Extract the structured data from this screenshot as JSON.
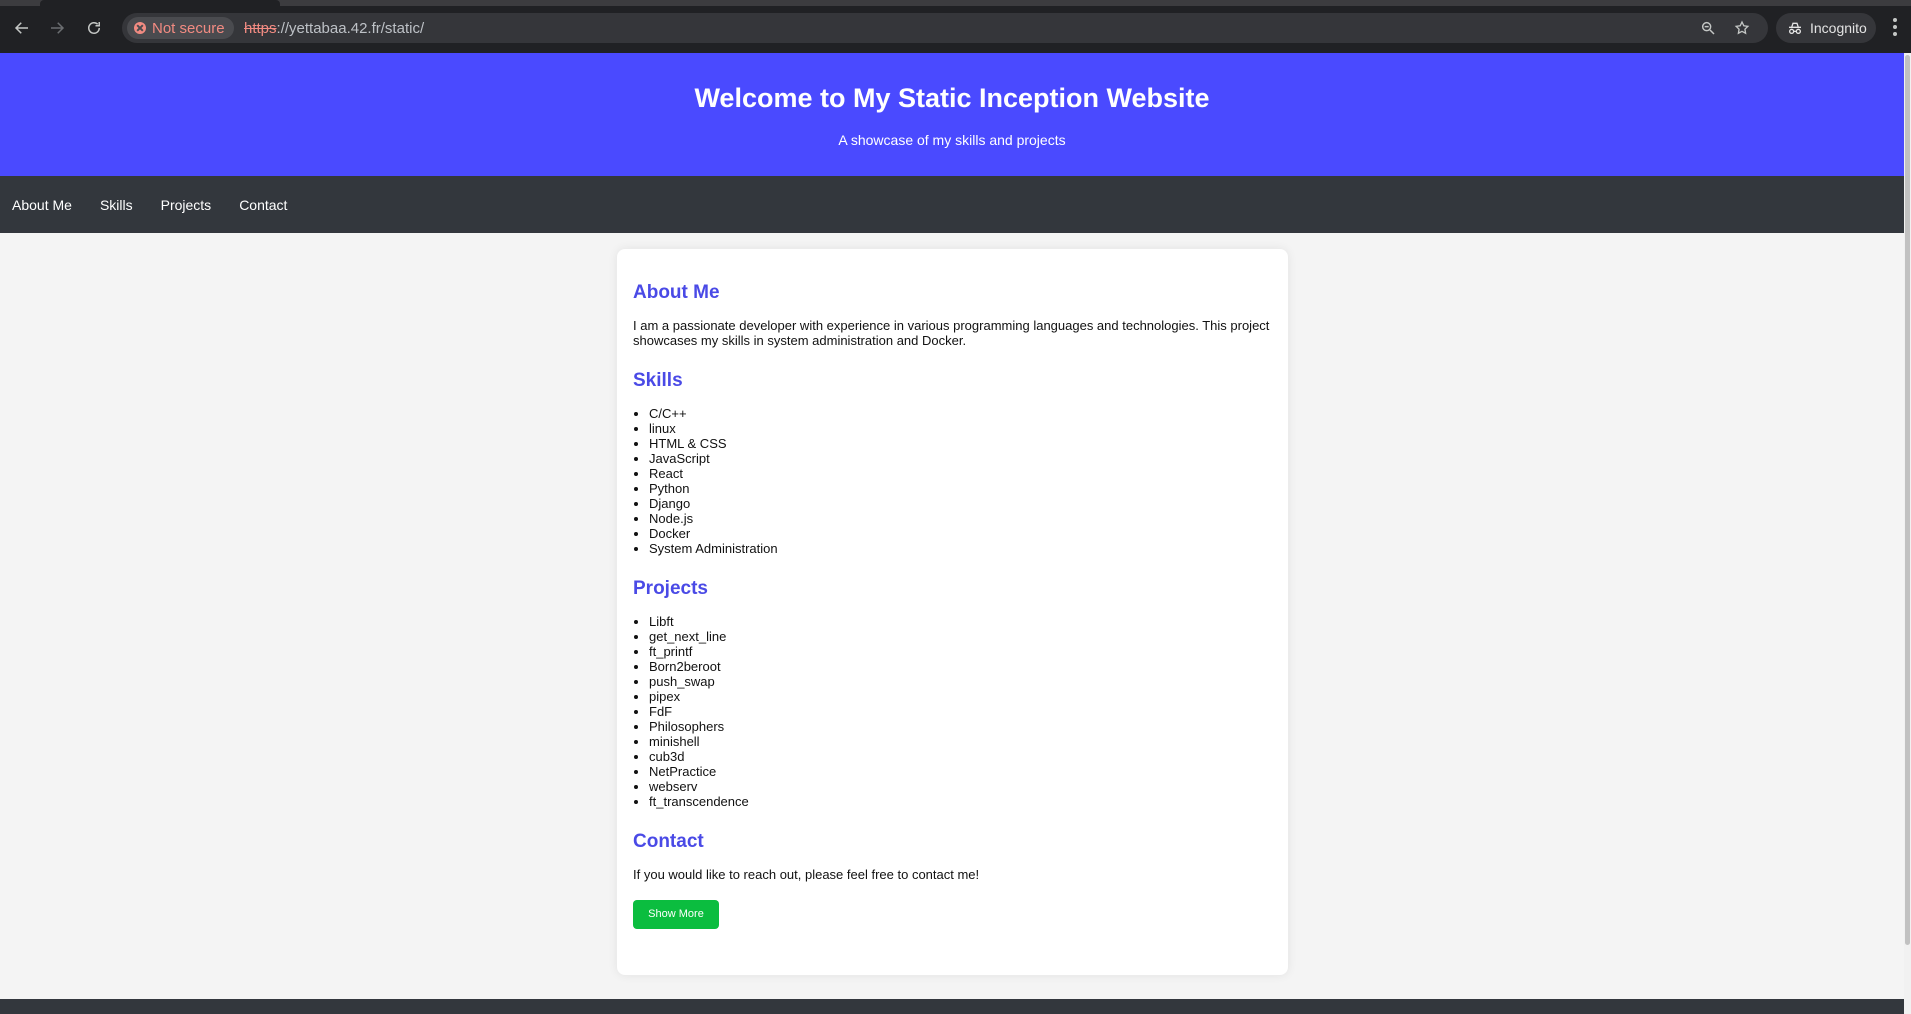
{
  "browser": {
    "security_label": "Not secure",
    "url_scheme": "https",
    "url_rest": "://yettabaa.42.fr/static/",
    "profile_label": "Incognito",
    "icons": [
      "back-arrow-icon",
      "forward-arrow-icon",
      "reload-icon",
      "zoom-icon",
      "star-icon",
      "incognito-icon",
      "kebab-menu-icon"
    ]
  },
  "header": {
    "title": "Welcome to My Static Inception Website",
    "subtitle": "A showcase of my skills and projects",
    "bg_color": "#4a4aff"
  },
  "nav": {
    "items": [
      {
        "label": "About Me"
      },
      {
        "label": "Skills"
      },
      {
        "label": "Projects"
      },
      {
        "label": "Contact"
      }
    ]
  },
  "about": {
    "heading": "About Me",
    "text": "I am a passionate developer with experience in various programming languages and technologies. This project showcases my skills in system administration and Docker."
  },
  "skills": {
    "heading": "Skills",
    "items": [
      "C/C++",
      "linux",
      "HTML & CSS",
      "JavaScript",
      "React",
      "Python",
      "Django",
      "Node.js",
      "Docker",
      "System Administration"
    ]
  },
  "projects": {
    "heading": "Projects",
    "items": [
      "Libft",
      "get_next_line",
      "ft_printf",
      "Born2beroot",
      "push_swap",
      "pipex",
      "FdF",
      "Philosophers",
      "minishell",
      "cub3d",
      "NetPractice",
      "webserv",
      "ft_transcendence"
    ]
  },
  "contact": {
    "heading": "Contact",
    "text": "If you would like to reach out, please feel free to contact me!",
    "button_label": "Show More",
    "button_color": "#0bbd3f"
  }
}
